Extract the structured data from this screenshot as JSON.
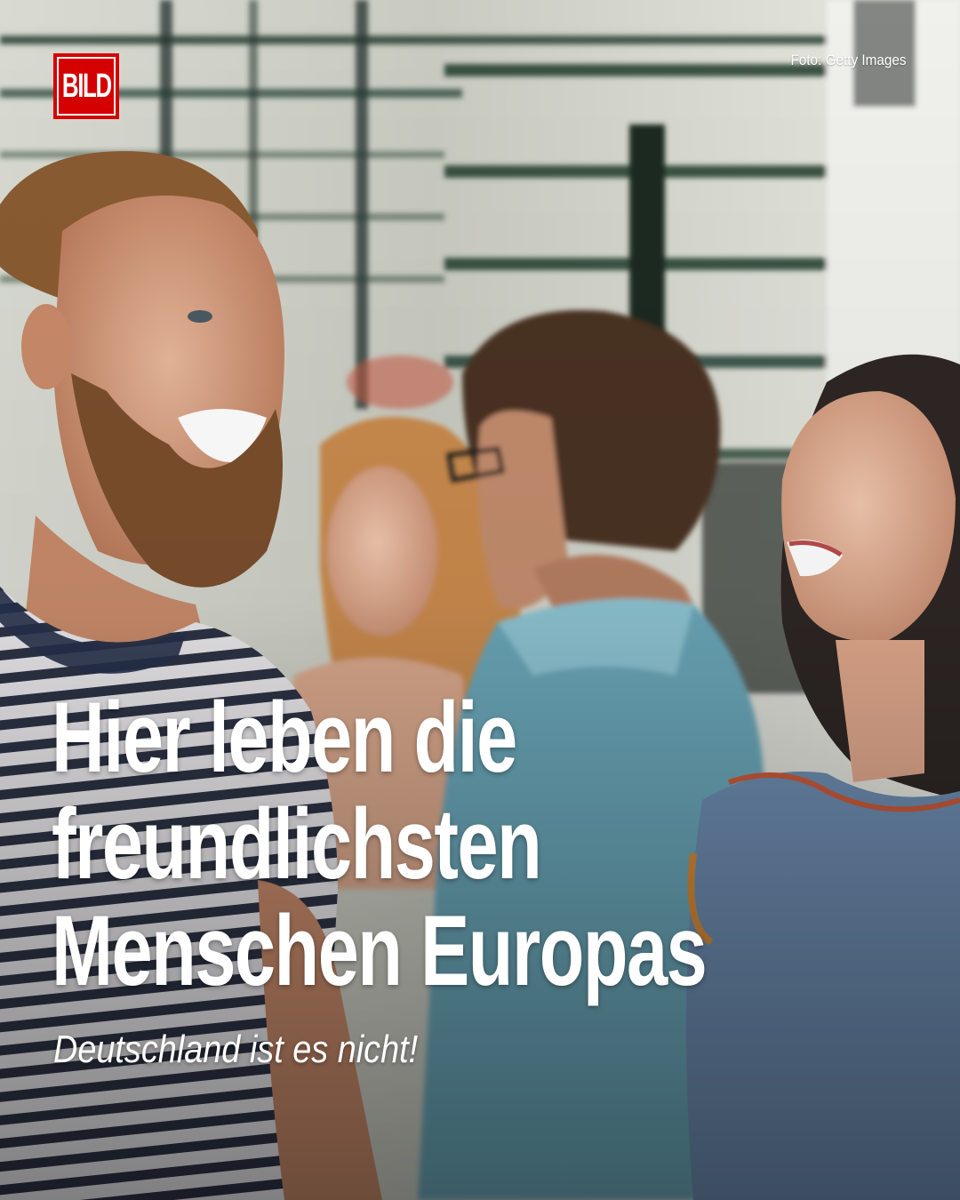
{
  "brand": {
    "logo_text": "BILD",
    "color": "#d50000"
  },
  "photo_credit": "Foto: Getty Images",
  "headline": {
    "lines": [
      "Hier leben die",
      "freundlichsten",
      "Menschen Europas"
    ]
  },
  "subheadline": "Deutschland ist es nicht!",
  "photo": {
    "description_icon": "photo-of-people-laughing"
  }
}
